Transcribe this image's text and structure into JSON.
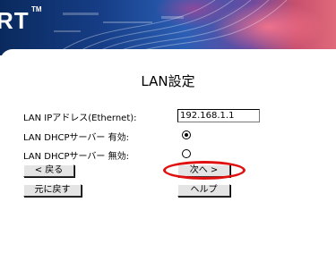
{
  "header": {
    "brand_text": "RT",
    "brand_tm": "TM"
  },
  "page": {
    "title": "LAN設定"
  },
  "form": {
    "ip_label": "LAN IPアドレス(Ethernet):",
    "ip_value": "192.168.1.1",
    "dhcp_on_label": "LAN DHCPサーバー 有効:",
    "dhcp_on_selected": true,
    "dhcp_off_label": "LAN DHCPサーバー 無効:",
    "dhcp_off_selected": false
  },
  "buttons": {
    "back": "< 戻る",
    "next": "次へ >",
    "reset": "元に戻す",
    "help": "ヘルプ"
  },
  "colors": {
    "highlight": "#e01010"
  }
}
